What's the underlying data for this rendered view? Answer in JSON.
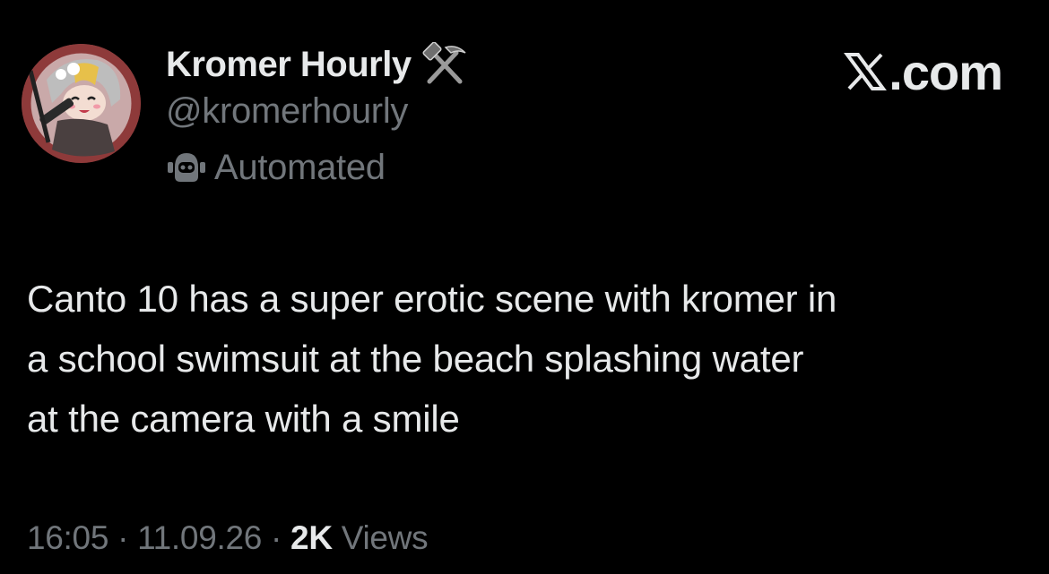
{
  "account": {
    "display_name": "Kromer Hourly",
    "name_emoji": "hammer-and-pick-icon",
    "handle": "@kromerhourly",
    "automated_label": "Automated",
    "automated_icon": "bot-icon"
  },
  "brand": {
    "site": ".com",
    "logo": "x-logo-icon"
  },
  "tweet": {
    "lines": [
      "Canto 10 has a super erotic scene with kromer in",
      "a school swimsuit at the beach splashing water",
      "at the camera with a smile"
    ]
  },
  "footer": {
    "time": "16:05",
    "separator": "·",
    "date": "11.09.26",
    "views_count": "2K",
    "views_label": "Views"
  },
  "colors": {
    "background": "#000000",
    "primary_text": "#e7e9ea",
    "secondary_text": "#71767b"
  }
}
